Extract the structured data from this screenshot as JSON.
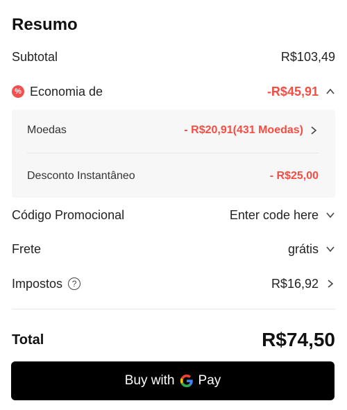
{
  "title": "Resumo",
  "subtotal": {
    "label": "Subtotal",
    "value": "R$103,49"
  },
  "savings": {
    "badge": "%",
    "label": "Economia de",
    "value": "-R$45,91",
    "items": [
      {
        "label": "Moedas",
        "value": "- R$20,91(431 Moedas)"
      },
      {
        "label": "Desconto Instantâneo",
        "value": "- R$25,00"
      }
    ]
  },
  "promo": {
    "label": "Código Promocional",
    "placeholder": "Enter code here"
  },
  "shipping": {
    "label": "Frete",
    "value": "grátis"
  },
  "taxes": {
    "label": "Impostos",
    "help": "?",
    "value": "R$16,92"
  },
  "total": {
    "label": "Total",
    "value": "R$74,50"
  },
  "payment_button": {
    "prefix": "Buy with",
    "suffix": "Pay",
    "bg": "#000000"
  },
  "colors": {
    "accent_red": "#f44e44",
    "panel_bg": "#f7f7f7"
  },
  "icons": [
    "savings-badge-icon",
    "chevron-up-icon",
    "chevron-right-icon",
    "chevron-down-icon",
    "help-icon",
    "google-g-icon"
  ]
}
